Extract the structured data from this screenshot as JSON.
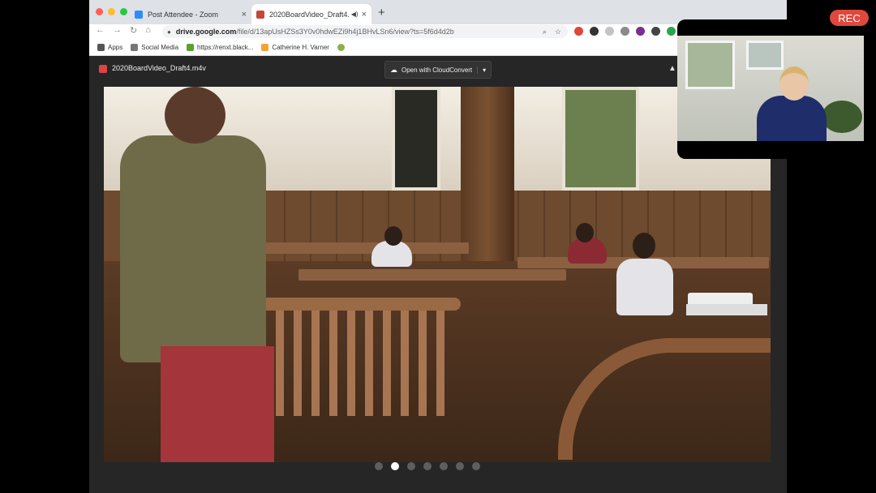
{
  "browser": {
    "tabs": [
      {
        "title": "Post Attendee - Zoom",
        "close": "×",
        "active": false,
        "favicon_color": "#2d8cff"
      },
      {
        "title": "2020BoardVideo_Draft4.m",
        "close": "×",
        "active": true,
        "favicon_color": "#c4473a",
        "speaker": "◀)"
      }
    ],
    "new_tab": "+",
    "address": {
      "host": "drive.google.com",
      "path": "/file/d/13apUsHZSs3Y0v0hdwEZi9h4j1BHvLSn6/view?ts=5f6d4d2b",
      "icons": [
        "⌕",
        "☆"
      ]
    },
    "nav_icons": [
      "←",
      "→",
      "↻",
      "⌂"
    ],
    "extension_colors": [
      "#e0453b",
      "#333333",
      "#c4c4c4",
      "#8a8a8a",
      "#7a2f8c",
      "#444444",
      "#2ea44f",
      "#aaaaaa"
    ],
    "bookmarks": [
      {
        "label": "Apps",
        "icon": "apps-grid-icon",
        "color": "#555555"
      },
      {
        "label": "Social Media",
        "icon": "folder-icon",
        "color": "#777777"
      },
      {
        "label": "https://renxt.black...",
        "icon": "blackbaud-icon",
        "color": "#5aa02c"
      },
      {
        "label": "Catherine H. Varner",
        "icon": "cloud-icon",
        "color": "#f4a236"
      },
      {
        "label": "",
        "icon": "leaf-icon",
        "color": "#8ab04a"
      }
    ]
  },
  "viewer": {
    "filename": "2020BoardVideo_Draft4.m4v",
    "open_with": "Open with CloudConvert",
    "dropdown": "▾",
    "slide_count": 7,
    "active_slide": 2
  },
  "zoom": {
    "rec_label": "REC"
  }
}
